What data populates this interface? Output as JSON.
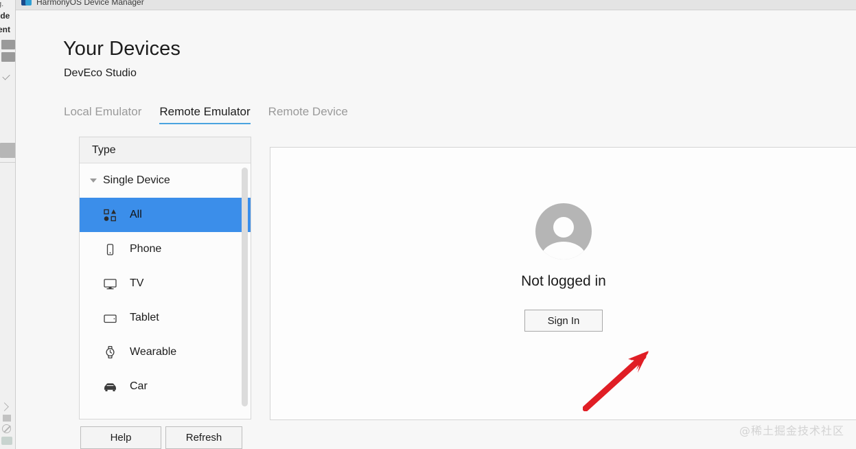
{
  "window": {
    "title": "HarmonyOS Device Manager",
    "icon": "harmonyos-logo-icon"
  },
  "header": {
    "title": "Your Devices",
    "subtitle": "DevEco Studio"
  },
  "tabs": [
    {
      "label": "Local Emulator",
      "active": false
    },
    {
      "label": "Remote Emulator",
      "active": true
    },
    {
      "label": "Remote Device",
      "active": false
    }
  ],
  "type_panel": {
    "header": "Type",
    "group": {
      "label": "Single Device",
      "expanded": true,
      "caret_icon": "chevron-down-icon"
    },
    "items": [
      {
        "label": "All",
        "icon": "all-devices-icon",
        "selected": true
      },
      {
        "label": "Phone",
        "icon": "phone-icon",
        "selected": false
      },
      {
        "label": "TV",
        "icon": "tv-icon",
        "selected": false
      },
      {
        "label": "Tablet",
        "icon": "tablet-icon",
        "selected": false
      },
      {
        "label": "Wearable",
        "icon": "watch-icon",
        "selected": false
      },
      {
        "label": "Car",
        "icon": "car-icon",
        "selected": false
      }
    ]
  },
  "main_panel": {
    "avatar_icon": "user-avatar-icon",
    "status_text": "Not logged in",
    "sign_in_label": "Sign In"
  },
  "footer": {
    "help_label": "Help",
    "refresh_label": "Refresh"
  },
  "annotation": {
    "arrow_color": "#e01e25",
    "arrow_target": "sign-in-button"
  },
  "watermark": "@稀土掘金技术社区",
  "colors": {
    "selection_blue": "#3b8eea",
    "tab_underline": "#4aa3df",
    "window_bg": "#f7f7f7",
    "panel_bg": "#fdfdfd",
    "avatar_gray": "#b5b5b5"
  },
  "background_ide": {
    "fragments": [
      "g.",
      "ide",
      "ent"
    ]
  }
}
